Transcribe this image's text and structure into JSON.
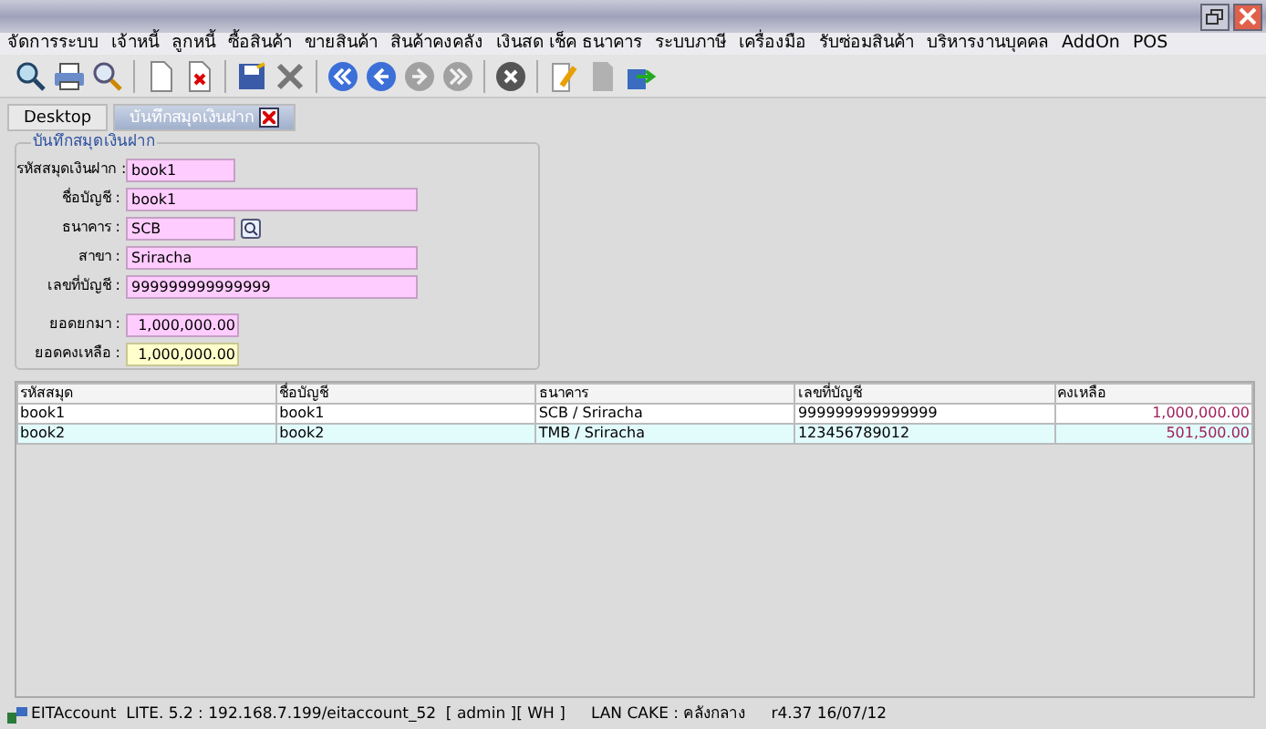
{
  "menu": [
    "จัดการระบบ",
    "เจ้าหนี้",
    "ลูกหนี้",
    "ซื้อสินค้า",
    "ขายสินค้า",
    "สินค้าคงคลัง",
    "เงินสด เช็ค ธนาคาร",
    "ระบบภาษี",
    "เครื่องมือ",
    "รับซ่อมสินค้า",
    "บริหารงานบุคคล",
    "AddOn",
    "POS"
  ],
  "toolbar": [
    {
      "kind": "zoom",
      "disabled": false
    },
    {
      "kind": "print",
      "disabled": false
    },
    {
      "kind": "search",
      "disabled": false
    },
    {
      "kind": "sep"
    },
    {
      "kind": "new",
      "disabled": false
    },
    {
      "kind": "delete",
      "disabled": false
    },
    {
      "kind": "sep"
    },
    {
      "kind": "save",
      "disabled": false
    },
    {
      "kind": "cancel",
      "disabled": false
    },
    {
      "kind": "sep"
    },
    {
      "kind": "first",
      "disabled": false
    },
    {
      "kind": "prev",
      "disabled": false
    },
    {
      "kind": "next",
      "disabled": true
    },
    {
      "kind": "last",
      "disabled": true
    },
    {
      "kind": "sep"
    },
    {
      "kind": "stop",
      "disabled": false
    },
    {
      "kind": "sep"
    },
    {
      "kind": "edit",
      "disabled": false
    },
    {
      "kind": "page",
      "disabled": true
    },
    {
      "kind": "export",
      "disabled": false
    }
  ],
  "tabs": [
    {
      "label": "Desktop",
      "selected": false,
      "kind": "home"
    },
    {
      "label": "บันทึกสมุดเงินฝาก",
      "selected": true,
      "kind": "document"
    }
  ],
  "form": {
    "title": "บันทึกสมุดเงินฝาก",
    "fields": [
      {
        "label": "รหัสสมุดเงินฝาก :",
        "value": "book1",
        "kind": "code",
        "readonly": false
      },
      {
        "label": "ชื่อบัญชี :",
        "value": "book1",
        "kind": "text",
        "readonly": false
      },
      {
        "label": "ธนาคาร :",
        "value": "SCB",
        "kind": "lookup",
        "readonly": false
      },
      {
        "label": "สาขา :",
        "value": "Sriracha",
        "kind": "text",
        "readonly": false
      },
      {
        "label": "เลขที่บัญชี :",
        "value": "999999999999999",
        "kind": "text",
        "readonly": false
      },
      {
        "label": "ยอดยกมา :",
        "value": "1,000,000.00",
        "kind": "amount",
        "readonly": false
      },
      {
        "label": "ยอดคงเหลือ :",
        "value": "1,000,000.00",
        "kind": "amount",
        "readonly": true
      }
    ]
  },
  "table": {
    "columns": [
      "รหัสสมุด",
      "ชื่อบัญชี",
      "ธนาคาร",
      "เลขที่บัญชี",
      "คงเหลือ"
    ],
    "rows": [
      {
        "cells": [
          "book1",
          "book1",
          "SCB / Sriracha",
          "999999999999999",
          "1,000,000.00"
        ],
        "selected": false
      },
      {
        "cells": [
          "book2",
          "book2",
          "TMB / Sriracha",
          "123456789012",
          "501,500.00"
        ],
        "selected": true
      }
    ]
  },
  "status_bar": [
    "EITAccount  LITE. 5.2 : 192.168.7.199/eitaccount_52  [ admin ][ WH ]",
    "LAN CAKE : คลังกลาง",
    "r4.37 16/07/12"
  ]
}
